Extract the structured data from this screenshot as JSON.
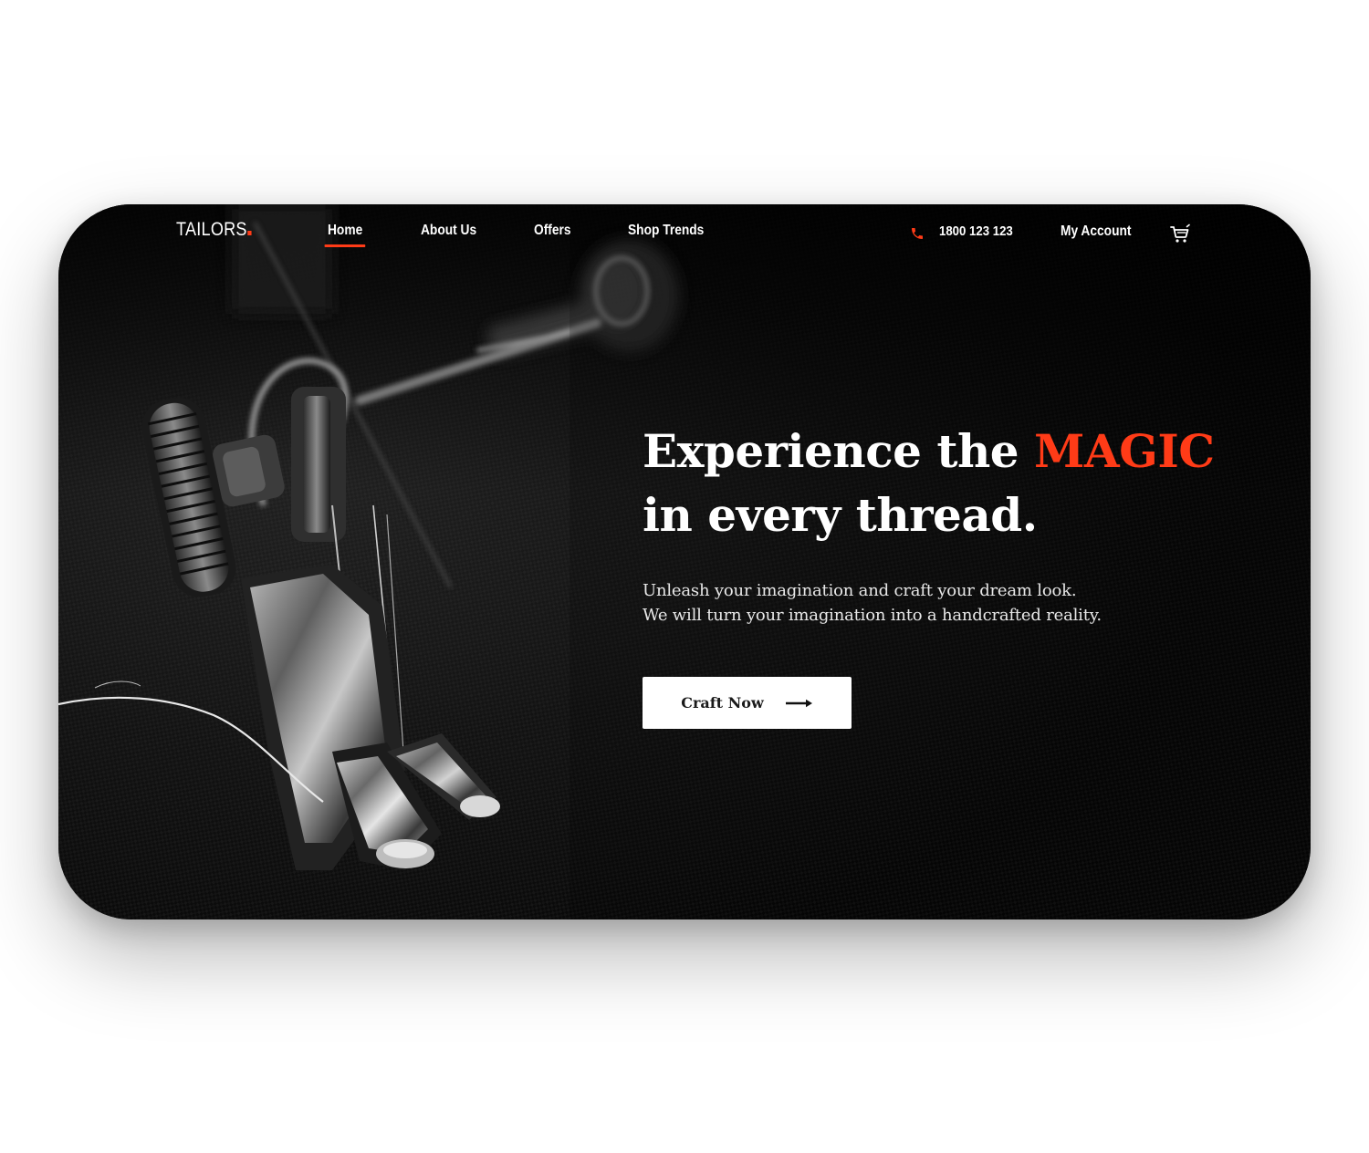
{
  "brand": {
    "name": "TAILORS",
    "accent_color": "#ff3b17"
  },
  "nav": {
    "links": [
      {
        "label": "Home",
        "active": true
      },
      {
        "label": "About Us",
        "active": false
      },
      {
        "label": "Offers",
        "active": false
      },
      {
        "label": "Shop Trends",
        "active": false
      }
    ],
    "phone": "1800 123 123",
    "phone_icon": "phone-icon",
    "account_label": "My Account",
    "cart_icon": "shopping-cart-icon"
  },
  "hero": {
    "headline_line1_prefix": "Experience the ",
    "headline_line1_accent": "MAGIC",
    "headline_line2": "in every thread.",
    "subtext_line1": "Unleash your imagination and craft your dream look.",
    "subtext_line2": "We will turn your imagination into a handcrafted reality.",
    "cta_label": "Craft Now",
    "cta_icon": "arrow-right-icon",
    "background_image": "sewing-machine-presser-foot-on-dark-fabric"
  }
}
